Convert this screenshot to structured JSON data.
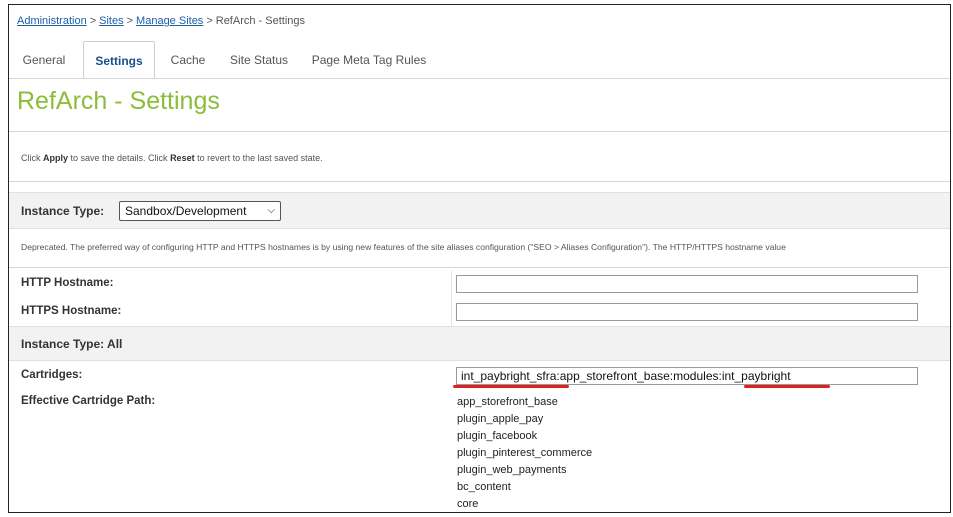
{
  "breadcrumb": {
    "items": [
      "Administration",
      "Sites",
      "Manage Sites"
    ],
    "separator": ">",
    "current": "RefArch - Settings"
  },
  "tabs": [
    {
      "label": "General",
      "active": false
    },
    {
      "label": "Settings",
      "active": true
    },
    {
      "label": "Cache",
      "active": false
    },
    {
      "label": "Site Status",
      "active": false
    },
    {
      "label": "Page Meta Tag Rules",
      "active": false
    }
  ],
  "page_title": "RefArch - Settings",
  "info": {
    "prefix": "Click ",
    "apply": "Apply",
    "middle": " to save the details. Click ",
    "reset": "Reset",
    "suffix": " to revert to the last saved state."
  },
  "instance_type_dev": {
    "label": "Instance Type:",
    "selected": "Sandbox/Development"
  },
  "deprecated_note": "Deprecated. The preferred way of configuring HTTP and HTTPS hostnames is by using new features of the site aliases configuration (\"SEO > Aliases Configuration\"). The HTTP/HTTPS hostname value",
  "hostnames": {
    "http_label": "HTTP Hostname:",
    "http_value": "",
    "https_label": "HTTPS Hostname:",
    "https_value": ""
  },
  "instance_type_all": {
    "label": "Instance Type:  All"
  },
  "cartridges": {
    "label": "Cartridges:",
    "value": "int_paybright_sfra:app_storefront_base:modules:int_paybright"
  },
  "effective_path": {
    "label": "Effective Cartridge Path:",
    "items": [
      "app_storefront_base",
      "plugin_apple_pay",
      "plugin_facebook",
      "plugin_pinterest_commerce",
      "plugin_web_payments",
      "bc_content",
      "core"
    ]
  },
  "colors": {
    "title_green": "#8cbd3a",
    "link_blue": "#1a5ea8",
    "highlight_red": "#e02020"
  }
}
